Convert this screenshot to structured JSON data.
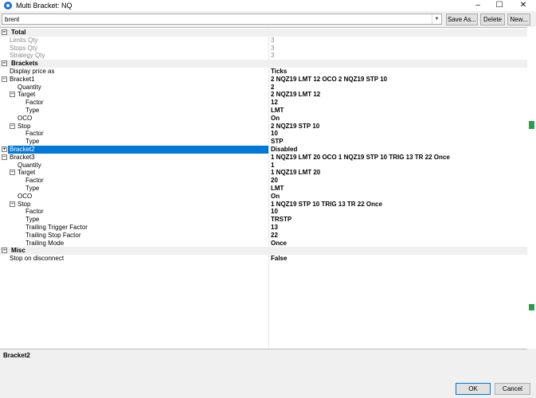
{
  "window": {
    "title": "Multi Bracket: NQ",
    "minimize": "–",
    "maximize": "☐",
    "close": "✕"
  },
  "toolbar": {
    "template_value": "brent",
    "save_as": "Save As...",
    "delete": "Delete",
    "new": "New..."
  },
  "grid": {
    "rows": [
      {
        "label": "Total",
        "value": "",
        "category": true,
        "expander": "⊟"
      },
      {
        "label": "Limits Qty",
        "value": "3",
        "muted": true
      },
      {
        "label": "Stops Qty",
        "value": "3",
        "muted": true
      },
      {
        "label": "Strategy Qty",
        "value": "3",
        "muted": true
      },
      {
        "label": "Brackets",
        "value": "",
        "category": true,
        "expander": "⊟"
      },
      {
        "label": "Display price as",
        "value": "Ticks"
      },
      {
        "label": "Bracket1",
        "value": "2 NQZ19 LMT 12 OCO 2 NQZ19 STP 10",
        "expander": "⊟"
      },
      {
        "label": "Quantity",
        "value": "2"
      },
      {
        "label": "Target",
        "value": "2 NQZ19 LMT 12",
        "expander": "⊟"
      },
      {
        "label": "Factor",
        "value": "12"
      },
      {
        "label": "Type",
        "value": "LMT"
      },
      {
        "label": "OCO",
        "value": "On"
      },
      {
        "label": "Stop",
        "value": "2 NQZ19 STP 10",
        "expander": "⊟"
      },
      {
        "label": "Factor",
        "value": "10"
      },
      {
        "label": "Type",
        "value": "STP"
      },
      {
        "label": "Bracket2",
        "value": "Disabled",
        "expander": "⊞",
        "selected": true
      },
      {
        "label": "Bracket3",
        "value": "1 NQZ19 LMT 20 OCO 1 NQZ19 STP 10 TRIG 13 TR 22 Once",
        "expander": "⊟"
      },
      {
        "label": "Quantity",
        "value": "1"
      },
      {
        "label": "Target",
        "value": "1 NQZ19 LMT 20",
        "expander": "⊟"
      },
      {
        "label": "Factor",
        "value": "20"
      },
      {
        "label": "Type",
        "value": "LMT"
      },
      {
        "label": "OCO",
        "value": "On"
      },
      {
        "label": "Stop",
        "value": "1 NQZ19 STP 10 TRIG 13 TR 22 Once",
        "expander": "⊟"
      },
      {
        "label": "Factor",
        "value": "10"
      },
      {
        "label": "Type",
        "value": "TRSTP"
      },
      {
        "label": "Trailing Trigger Factor",
        "value": "13"
      },
      {
        "label": "Trailing Stop Factor",
        "value": "22"
      },
      {
        "label": "Trailing Mode",
        "value": "Once"
      },
      {
        "label": "Misc",
        "value": "",
        "category": true,
        "expander": "⊟"
      },
      {
        "label": "Stop on disconnect",
        "value": "False"
      }
    ]
  },
  "description": {
    "title": "Bracket2"
  },
  "buttons": {
    "ok": "OK",
    "cancel": "Cancel"
  },
  "colors": {
    "selection": "#0078d7",
    "accent_scroll": "#2e9b4c"
  }
}
